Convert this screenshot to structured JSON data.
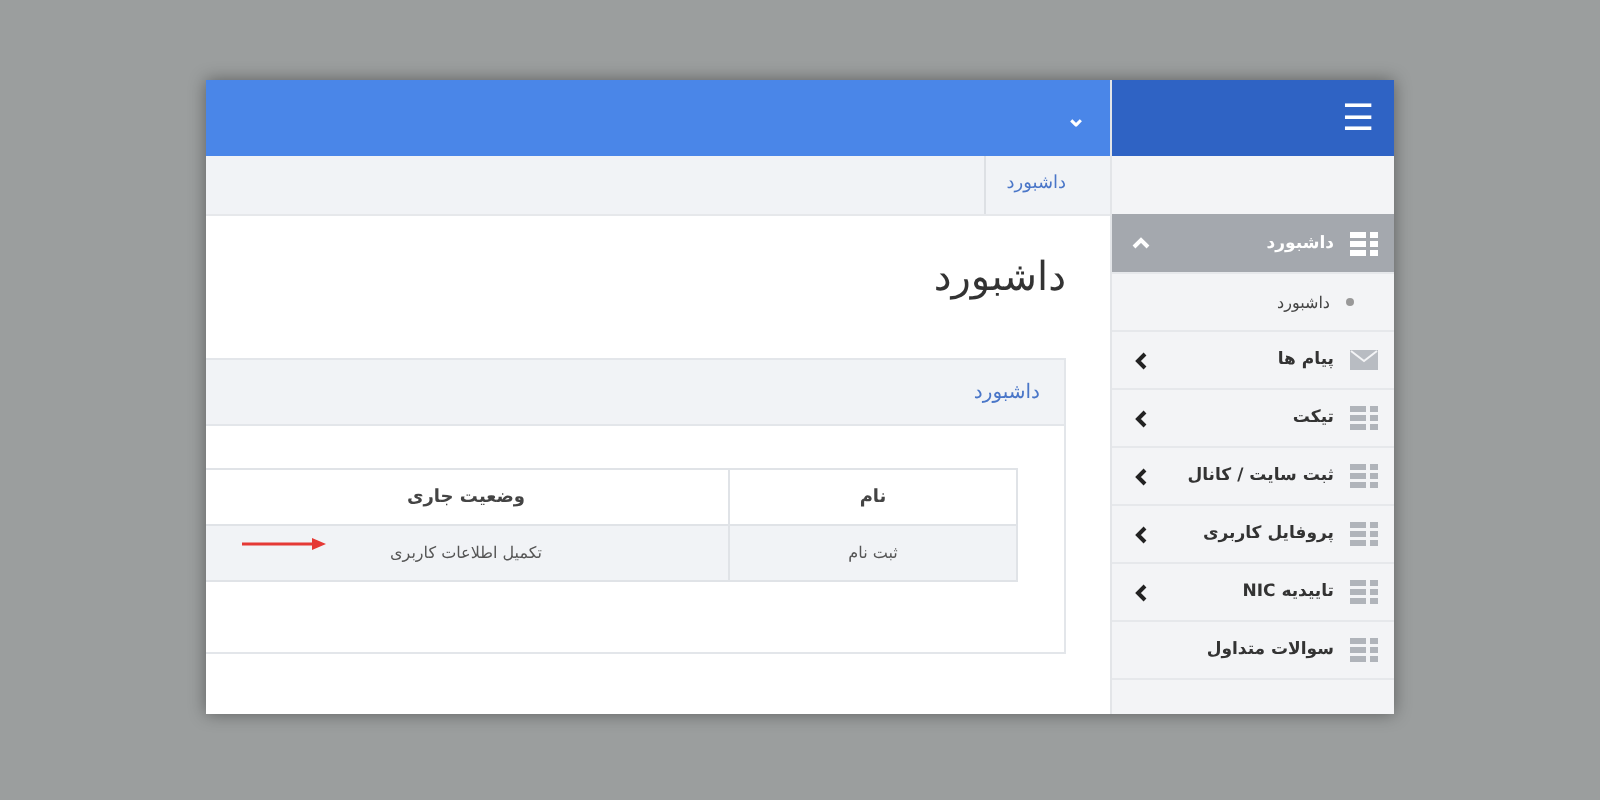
{
  "topbar": {
    "menu_toggle": "☰",
    "dropdown": "⌄"
  },
  "breadcrumb": [
    "داشبورد"
  ],
  "page_title": "داشبورد",
  "card": {
    "title": "داشبورد",
    "table": {
      "columns": [
        "نام",
        "وضعیت جاری"
      ],
      "rows": [
        [
          "ثبت نام",
          "تکمیل اطلاعات کاربری"
        ]
      ]
    }
  },
  "sidebar": {
    "items": [
      {
        "label": "داشبورد",
        "kind": "menu",
        "selected": true,
        "expanded": true,
        "children": [
          {
            "label": "داشبورد"
          }
        ]
      },
      {
        "label": "پیام ها",
        "kind": "menu",
        "selected": false,
        "expanded": false
      },
      {
        "label": "تیکت",
        "kind": "menu",
        "selected": false,
        "expanded": false
      },
      {
        "label": "ثبت سایت / کانال",
        "kind": "menu",
        "selected": false,
        "expanded": false
      },
      {
        "label": "پروفایل کاربری",
        "kind": "menu",
        "selected": false,
        "expanded": false
      },
      {
        "label": "تاییدیه NIC",
        "kind": "menu",
        "selected": false,
        "expanded": false
      },
      {
        "label": "سوالات متداول",
        "kind": "link",
        "selected": false
      }
    ]
  }
}
